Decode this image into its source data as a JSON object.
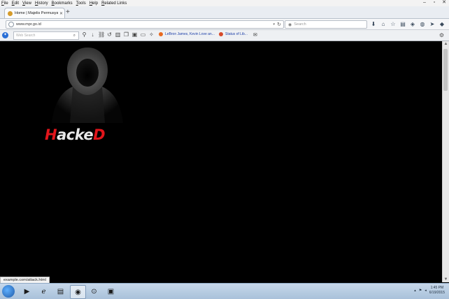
{
  "menu": [
    "File",
    "Edit",
    "View",
    "History",
    "Bookmarks",
    "Tools",
    "Help",
    "Related Links"
  ],
  "tab": {
    "title": "Home | Majelis Permusyaw..."
  },
  "navbar": {
    "url": "www.mpr.go.id",
    "search_placeholder": "Search"
  },
  "toolbar": {
    "search_placeholder": "Web Search",
    "bookmarks": [
      {
        "label": "LeBron James, Kevin Love an..."
      },
      {
        "label": "Status of Lib..."
      }
    ]
  },
  "page": {
    "hacked_text_white": "Hacke",
    "hacked_first": "H",
    "hacked_last": "D",
    "hacked_mid": "acke"
  },
  "status": {
    "link": "example.com/attack.html"
  },
  "taskbar": {
    "time": "1:45 PM",
    "date": "6/19/2015"
  },
  "colors": {
    "accent_red": "#e2151b",
    "page_bg": "#000000"
  }
}
